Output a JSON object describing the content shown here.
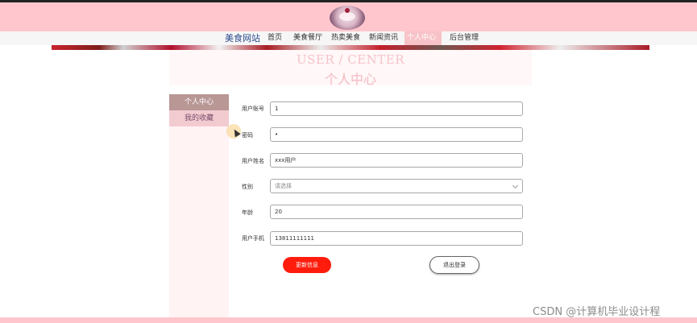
{
  "nav": {
    "brand": "美食网站",
    "items": [
      "首页",
      "美食餐厅",
      "热卖美食",
      "新闻资讯",
      "个人中心",
      "后台管理"
    ],
    "active": "个人中心"
  },
  "title": {
    "en": "USER / CENTER",
    "cn": "个人中心"
  },
  "sidebar": {
    "items": [
      "个人中心",
      "我的收藏"
    ]
  },
  "form": {
    "fields": [
      {
        "label": "用户账号",
        "value": "1"
      },
      {
        "label": "密码",
        "value": "•"
      },
      {
        "label": "用户姓名",
        "value": "xxx用户"
      },
      {
        "label": "性别",
        "value": "请选择"
      },
      {
        "label": "年龄",
        "value": "20"
      },
      {
        "label": "用户手机",
        "value": "13811111111"
      }
    ],
    "update_label": "更新信息",
    "logout_label": "退出登录"
  },
  "watermark": "CSDN @计算机毕业设计程",
  "colors": {
    "header_bg": "#ffc7cd",
    "active_nav": "#f7c3c8",
    "sidebar_active": "#b89795",
    "update_button": "#ff1c0d"
  },
  "icons": {
    "logo": "food-dish-logo",
    "select": "chevron-down-icon",
    "cursor": "mouse-cursor-icon"
  }
}
